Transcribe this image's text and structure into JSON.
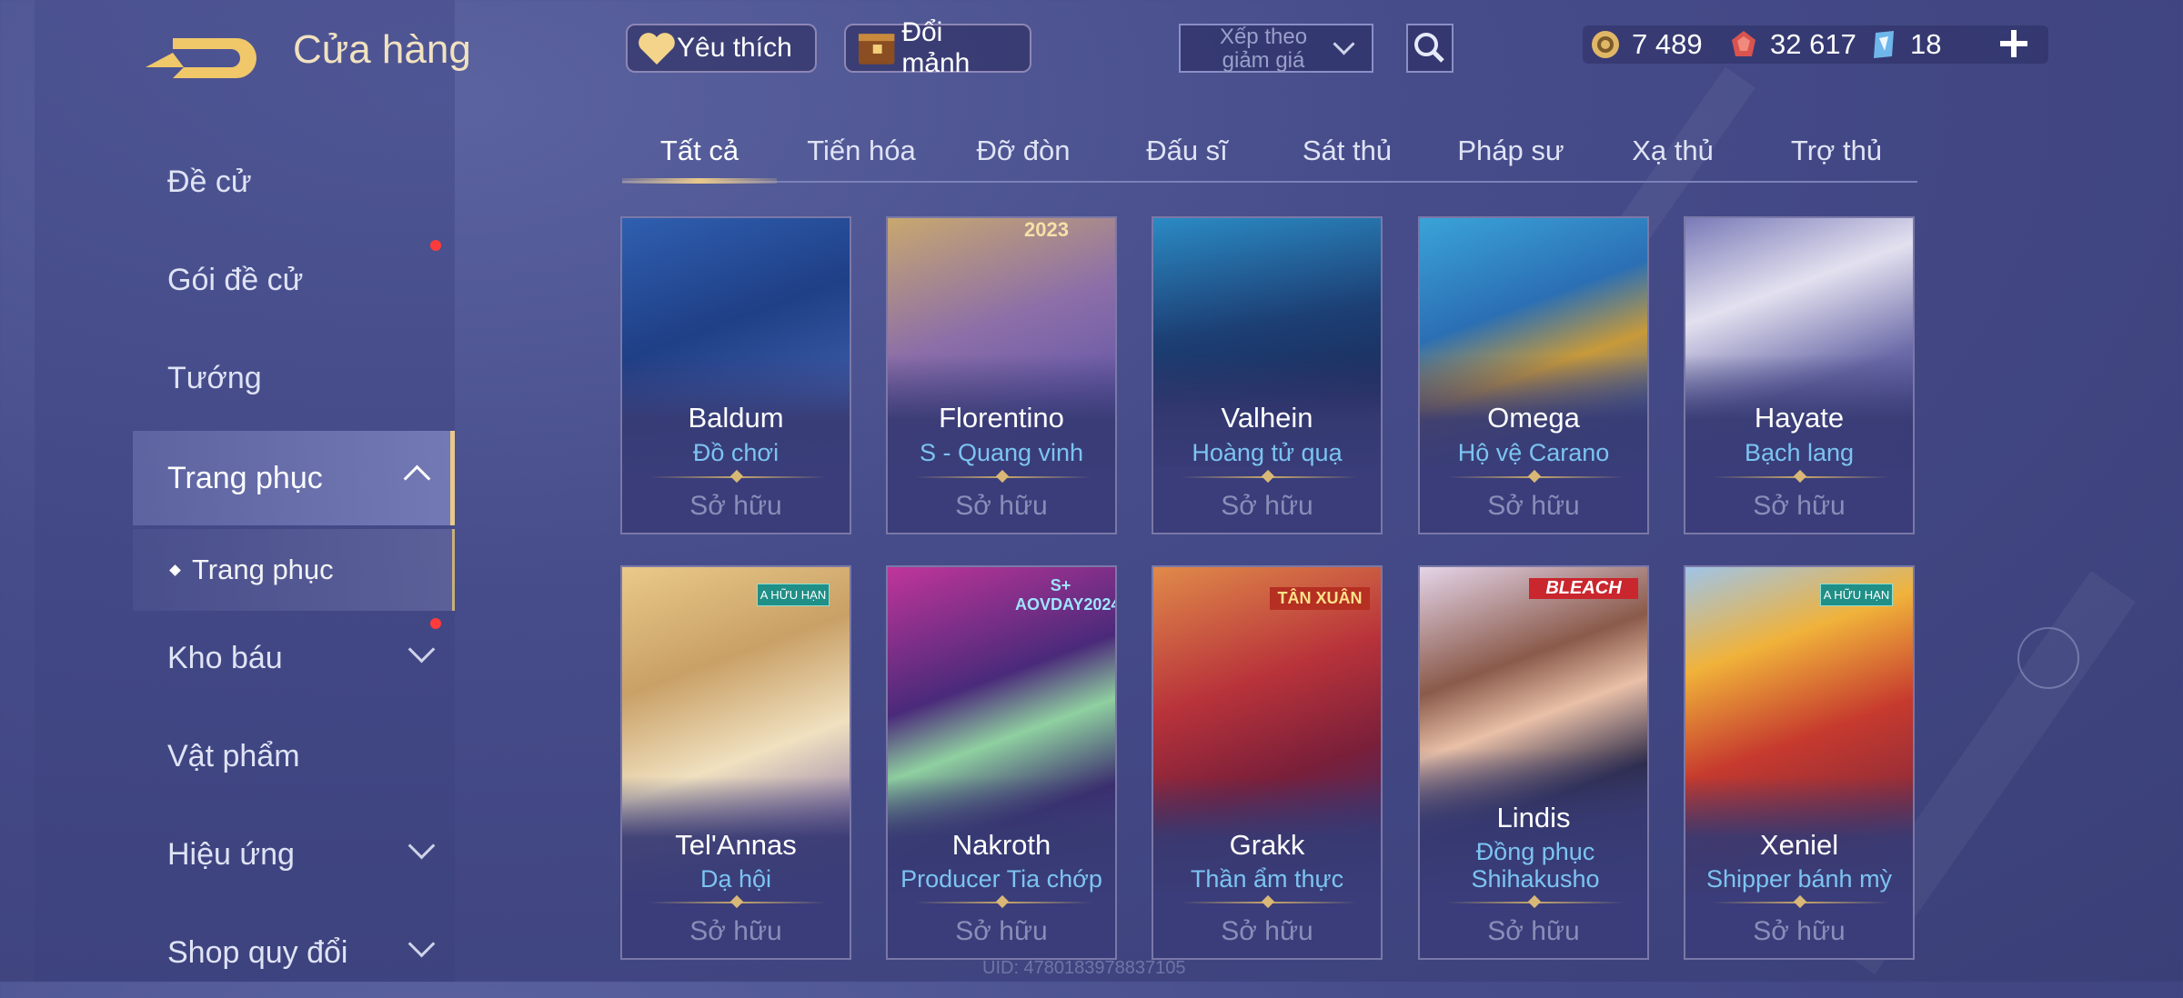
{
  "header": {
    "title": "Cửa hàng"
  },
  "sidebar": {
    "items": [
      {
        "label": "Đề cử"
      },
      {
        "label": "Gói đề cử"
      },
      {
        "label": "Tướng"
      },
      {
        "label": "Trang phục"
      },
      {
        "label": "Trang phục"
      },
      {
        "label": "Kho báu"
      },
      {
        "label": "Vật phẩm"
      },
      {
        "label": "Hiệu ứng"
      },
      {
        "label": "Shop quy đổi"
      }
    ]
  },
  "toolbar": {
    "favorite_label": "Yêu thích",
    "exchange_label": "Đổi mảnh",
    "sort_label": "Xếp theo giảm giá"
  },
  "currency": {
    "gold": "7 489",
    "vouchers": "32 617",
    "quan_huy": "18"
  },
  "tabs": [
    {
      "label": "Tất cả"
    },
    {
      "label": "Tiến hóa"
    },
    {
      "label": "Đỡ đòn"
    },
    {
      "label": "Đấu sĩ"
    },
    {
      "label": "Sát thủ"
    },
    {
      "label": "Pháp sư"
    },
    {
      "label": "Xạ thủ"
    },
    {
      "label": "Trợ thủ"
    }
  ],
  "skins": [
    {
      "hero": "Baldum",
      "skin": "Đồ chơi",
      "status": "Sở hữu"
    },
    {
      "hero": "Florentino",
      "skin": "S - Quang vinh",
      "status": "Sở hữu",
      "badge": "2023"
    },
    {
      "hero": "Valhein",
      "skin": "Hoàng tử quạ",
      "status": "Sở hữu"
    },
    {
      "hero": "Omega",
      "skin": "Hộ vệ Carano",
      "status": "Sở hữu"
    },
    {
      "hero": "Hayate",
      "skin": "Bạch lang",
      "status": "Sở hữu"
    },
    {
      "hero": "Tel'Annas",
      "skin": "Dạ hội",
      "status": "Sở hữu",
      "badge": "A HỮU HẠN"
    },
    {
      "hero": "Nakroth",
      "skin": "Producer Tia chớp",
      "status": "Sở hữu",
      "badge": "S+ AOVDAY2024"
    },
    {
      "hero": "Grakk",
      "skin": "Thần ẩm thực",
      "status": "Sở hữu",
      "badge": "TÂN XUÂN"
    },
    {
      "hero": "Lindis",
      "skin": "Đồng phục Shihakusho",
      "status": "Sở hữu",
      "badge": "BLEACH"
    },
    {
      "hero": "Xeniel",
      "skin": "Shipper bánh mỳ",
      "status": "Sở hữu",
      "badge": "A HỮU HẠN"
    }
  ],
  "footer": {
    "uid": "UID: 4780183978837105"
  },
  "colors": {
    "accent_gold": "#e8c98b",
    "skin_blue": "#7cc4f2",
    "owned_gray": "#8a8db8",
    "notification": "#ff3b3b"
  }
}
